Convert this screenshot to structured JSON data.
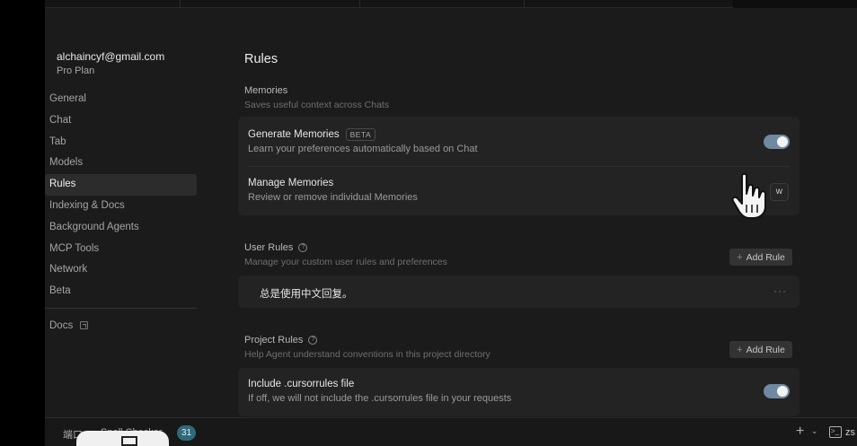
{
  "account": {
    "email": "alchaincyf@gmail.com",
    "plan": "Pro Plan"
  },
  "nav": {
    "items": [
      {
        "label": "General",
        "active": false
      },
      {
        "label": "Chat",
        "active": false
      },
      {
        "label": "Tab",
        "active": false
      },
      {
        "label": "Models",
        "active": false
      },
      {
        "label": "Rules",
        "active": true
      },
      {
        "label": "Indexing & Docs",
        "active": false
      },
      {
        "label": "Background Agents",
        "active": false
      },
      {
        "label": "MCP Tools",
        "active": false
      },
      {
        "label": "Network",
        "active": false
      },
      {
        "label": "Beta",
        "active": false
      }
    ],
    "docs_label": "Docs",
    "docs_icon": "external-link-icon"
  },
  "page": {
    "title": "Rules"
  },
  "memories": {
    "title": "Memories",
    "description": "Saves useful context across Chats",
    "generate": {
      "title": "Generate Memories",
      "badge": "BETA",
      "description": "Learn your preferences automatically based on Chat",
      "enabled": true
    },
    "manage": {
      "title": "Manage Memories",
      "description": "Review or remove individual Memories",
      "button_label": "w"
    }
  },
  "user_rules": {
    "title": "User Rules",
    "description": "Manage your custom user rules and preferences",
    "add_label": "Add Rule",
    "rules": [
      {
        "text": "总是使用中文回复。",
        "menu": "···"
      }
    ]
  },
  "project_rules": {
    "title": "Project Rules",
    "description": "Help Agent understand conventions in this project directory",
    "add_label": "Add Rule",
    "cursorrules": {
      "title": "Include .cursorrules file",
      "description": "If off, we will not include the .cursorrules file in your requests",
      "enabled": true
    }
  },
  "statusbar": {
    "port_label": "端口",
    "spell_label": "Spell Checker",
    "badge_count": "31",
    "plus": "+",
    "chevron": "⌄",
    "terminal_label": "zs"
  },
  "colors": {
    "toggle_on": "#6f89a2",
    "badge": "#2f6a7c",
    "background": "#1b1b1b",
    "card": "#232323"
  }
}
